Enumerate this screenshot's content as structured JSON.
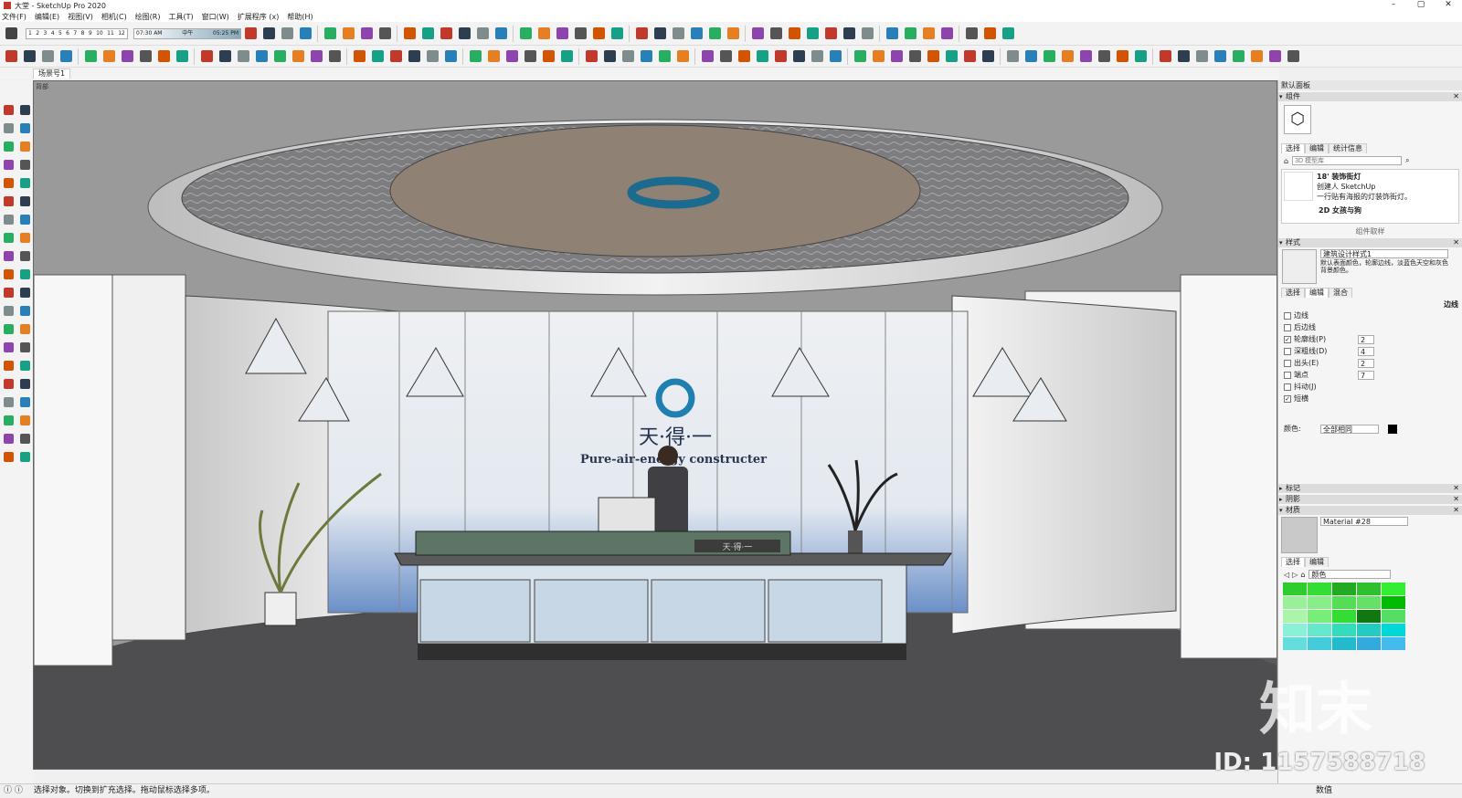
{
  "window": {
    "title": "大堂 - SketchUp Pro 2020",
    "controls": [
      "–",
      "▢",
      "✕"
    ]
  },
  "menu": [
    "文件(F)",
    "编辑(E)",
    "视图(V)",
    "相机(C)",
    "绘图(R)",
    "工具(T)",
    "窗口(W)",
    "扩展程序 (x)",
    "帮助(H)"
  ],
  "shadow_bar": {
    "months": [
      "1",
      "2",
      "3",
      "4",
      "5",
      "6",
      "7",
      "8",
      "9",
      "10",
      "11",
      "12"
    ],
    "time_start": "07:30 AM",
    "time_mid": "中午",
    "time_end": "05:25 PM"
  },
  "scene_tab": "场景号1",
  "viewport": {
    "label": "背部",
    "logo_text": "天·得·一",
    "slogan": "Pure-air-energy constructer",
    "desk_plaque": "天·得·一"
  },
  "tray": {
    "title": "默认面板",
    "components": {
      "header": "组件",
      "tabs": [
        "选择",
        "编辑",
        "统计信息"
      ],
      "search_placeholder": "3D 模型库",
      "items": [
        {
          "name": "18' 装饰街灯",
          "line1": "创建人 SketchUp",
          "line2": "一行贴有海报的灯装饰街灯。"
        },
        {
          "name": "2D 女孩与狗",
          "line1": "",
          "line2": ""
        }
      ],
      "footer": "组件取样"
    },
    "styles": {
      "header": "样式",
      "style_name": "建筑设计样式1",
      "style_desc": "默认表面颜色，轮廓边线，淡蓝色天空和灰色背景颜色。",
      "tabs": [
        "选择",
        "编辑",
        "混合"
      ],
      "edge_label": "边线",
      "options": [
        {
          "label": "边线",
          "checked": false,
          "value": ""
        },
        {
          "label": "后边线",
          "checked": false,
          "value": ""
        },
        {
          "label": "轮廓线(P)",
          "checked": true,
          "value": "2"
        },
        {
          "label": "深粗线(D)",
          "checked": false,
          "value": "4"
        },
        {
          "label": "出头(E)",
          "checked": false,
          "value": "2"
        },
        {
          "label": "端点",
          "checked": false,
          "value": "7"
        },
        {
          "label": "抖动(J)",
          "checked": false,
          "value": ""
        },
        {
          "label": "短横",
          "checked": true,
          "value": ""
        }
      ],
      "color_label": "颜色:",
      "color_value": "全部相同"
    },
    "collapsed": [
      "标记",
      "阴影"
    ],
    "materials": {
      "header": "材质",
      "material_name": "Material #28",
      "tabs": [
        "选择",
        "编辑"
      ],
      "category": "颜色",
      "swatch_colors": [
        "#2ecc2e",
        "#33dd33",
        "#22aa22",
        "#2fbf2f",
        "#33ee33",
        "#99f099",
        "#88ee88",
        "#55dd55",
        "#66e066",
        "#00bb00",
        "#aaf5aa",
        "#77ee77",
        "#33dd33",
        "#117711",
        "#55dd66",
        "#8bf0d8",
        "#66e8cc",
        "#33ddbb",
        "#22ccc0",
        "#00d8d8",
        "#66dddd",
        "#44ccdd",
        "#22bbcc",
        "#33aadd",
        "#44bbee"
      ]
    }
  },
  "status": {
    "text": "选择对象。切换到扩充选择。拖动鼠标选择多项。",
    "measure_label": "数值"
  },
  "watermark": {
    "id_text": "ID: 1157588718",
    "brand": "知末"
  }
}
